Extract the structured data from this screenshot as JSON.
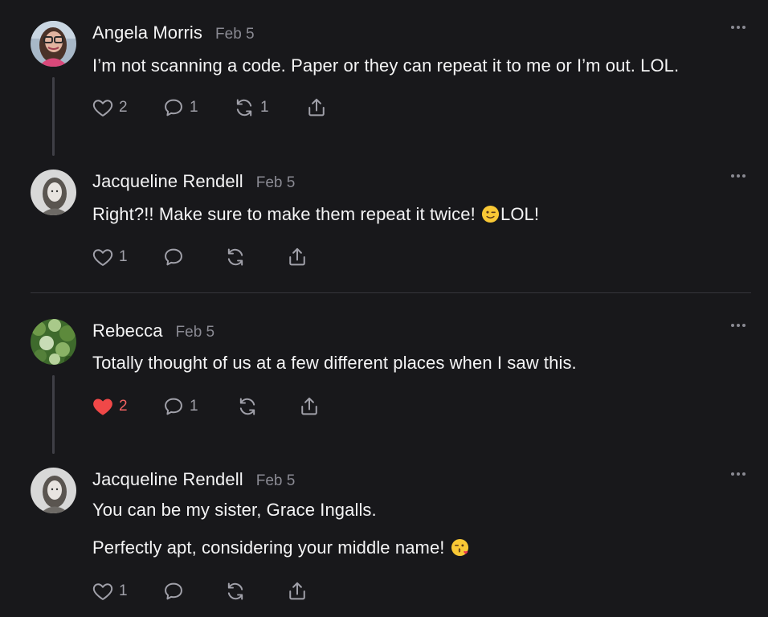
{
  "colors": {
    "background": "#18181b",
    "text": "#f4f4f5",
    "muted": "#8a8a93",
    "icon": "#a1a1aa",
    "liked": "#f26262",
    "thread_line": "#3f3f46"
  },
  "comments": [
    {
      "author": "Angela Morris",
      "date": "Feb 5",
      "avatar": "avatar-woman-glasses",
      "text": "I’m not scanning a code. Paper or they can repeat it to me or I’m out. LOL.",
      "likes": "2",
      "liked": false,
      "replies": "1",
      "restacks": "1"
    },
    {
      "author": "Jacqueline Rendell",
      "date": "Feb 5",
      "avatar": "avatar-woman-portrait",
      "text_before_emoji": "Right?!! Make sure to make them repeat it twice! ",
      "emoji": "winking-face-emoji",
      "text_after_emoji": "LOL!",
      "likes": "1",
      "liked": false,
      "replies": "",
      "restacks": ""
    },
    {
      "author": "Rebecca",
      "date": "Feb 5",
      "avatar": "avatar-foliage",
      "text": "Totally thought of us at a few different places when I saw this.",
      "likes": "2",
      "liked": true,
      "replies": "1",
      "restacks": ""
    },
    {
      "author": "Jacqueline Rendell",
      "date": "Feb 5",
      "avatar": "avatar-woman-portrait",
      "text_line1": "You can be my sister, Grace Ingalls.",
      "text_line2_before_emoji": "Perfectly apt, considering your middle name! ",
      "emoji": "kissing-face-emoji",
      "likes": "1",
      "liked": false,
      "replies": "",
      "restacks": ""
    }
  ]
}
